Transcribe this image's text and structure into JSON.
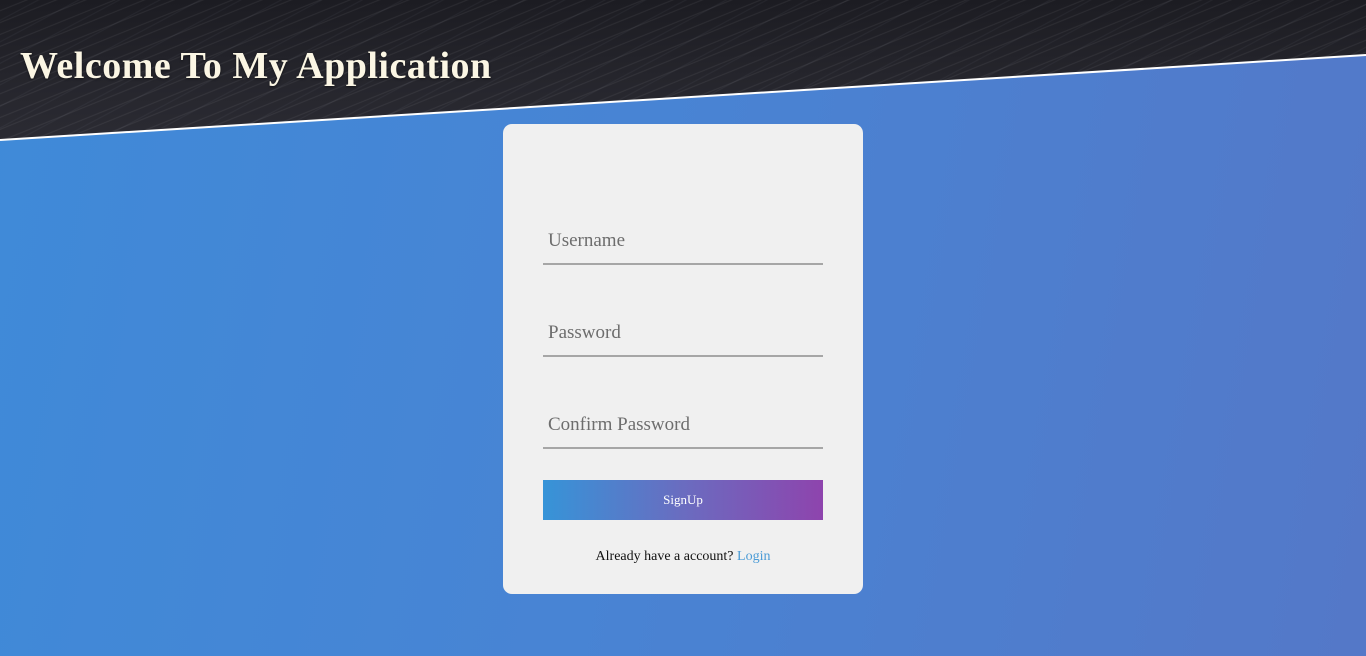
{
  "header": {
    "title": "Welcome To My Application"
  },
  "signup_form": {
    "username_placeholder": "Username",
    "password_placeholder": "Password",
    "confirm_password_placeholder": "Confirm Password",
    "username_value": "",
    "password_value": "",
    "confirm_password_value": "",
    "submit_label": "SignUp",
    "login_prompt": "Already have a account?",
    "login_link_label": "Login"
  },
  "colors": {
    "page_background": "#4686d6",
    "header_background": "#242429",
    "title_color": "#fbf6e4",
    "card_background": "#f0f0f0",
    "button_gradient_start": "#3694d8",
    "button_gradient_end": "#8e44ad",
    "link_color": "#4a9bd6"
  }
}
